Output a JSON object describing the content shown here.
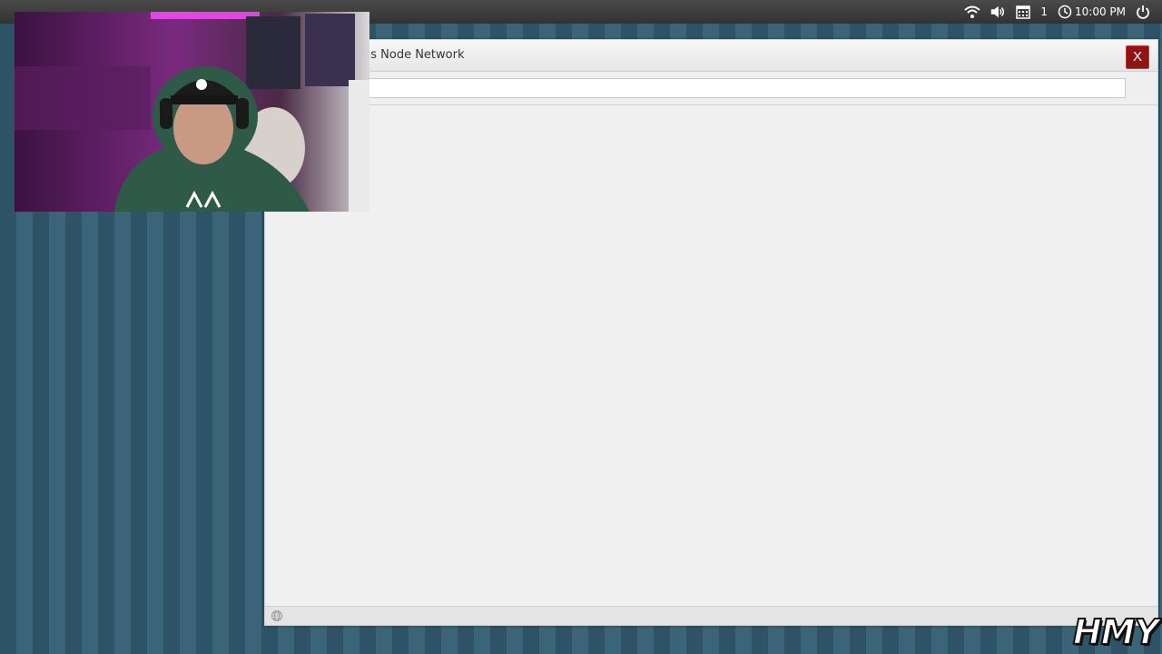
{
  "tray": {
    "workspace_count": "1",
    "clock": "10:00 PM"
  },
  "window": {
    "title": "us Node Network",
    "close_label": "X",
    "address_value": ""
  },
  "overlay": {
    "logo_text": "HMY"
  },
  "colors": {
    "close_button": "#8f1515",
    "desktop_stripe_dark": "#2f5366",
    "desktop_stripe_light": "#3b6478",
    "topbar": "#3a3a3a"
  }
}
